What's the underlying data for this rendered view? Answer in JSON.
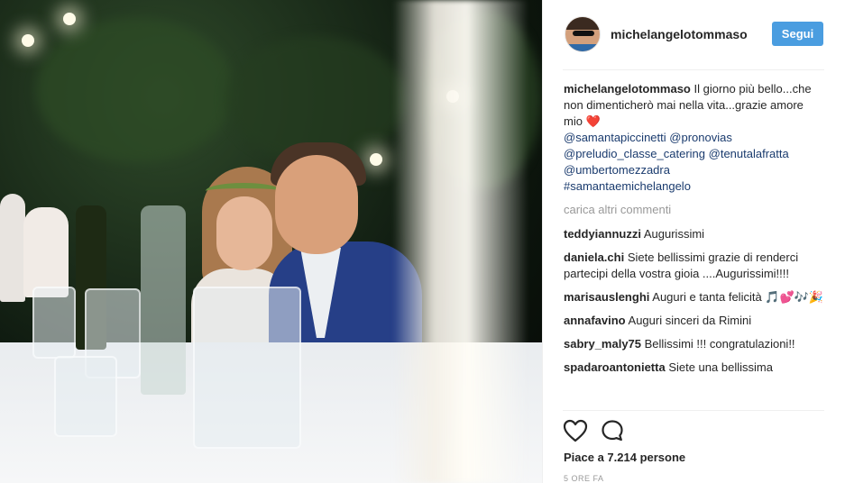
{
  "post": {
    "username": "michelangelotommaso",
    "follow_label": "Segui"
  },
  "caption": {
    "username": "michelangelotommaso",
    "text": " Il giorno più bello...che non dimenticherò mai nella vita...grazie amore mio ❤️",
    "tags": [
      "@samantapiccinetti",
      "@pronovias",
      "@preludio_classe_catering",
      "@tenutalafratta",
      "@umbertomezzadra",
      "#samantaemichelangelo"
    ]
  },
  "load_more_label": "carica altri commenti",
  "comments": [
    {
      "user": "teddyiannuzzi",
      "text": "Augurissimi"
    },
    {
      "user": "daniela.chi",
      "text": "Siete bellissimi grazie di renderci partecipi della vostra gioia ....Augurissimi!!!!"
    },
    {
      "user": "marisauslenghi",
      "text": "Auguri e tanta felicità 🎵💕🎶🎉"
    },
    {
      "user": "annafavino",
      "text": "Auguri sinceri da Rimini"
    },
    {
      "user": "sabry_maly75",
      "text": "Bellissimi !!! congratulazioni!!"
    },
    {
      "user": "spadaroantonietta",
      "text": "Siete una bellissima"
    }
  ],
  "likes_label": "Piace a 7.214 persone",
  "time_label": "5 ORE FA",
  "icons": {
    "like": "heart-icon",
    "comment": "comment-icon"
  }
}
